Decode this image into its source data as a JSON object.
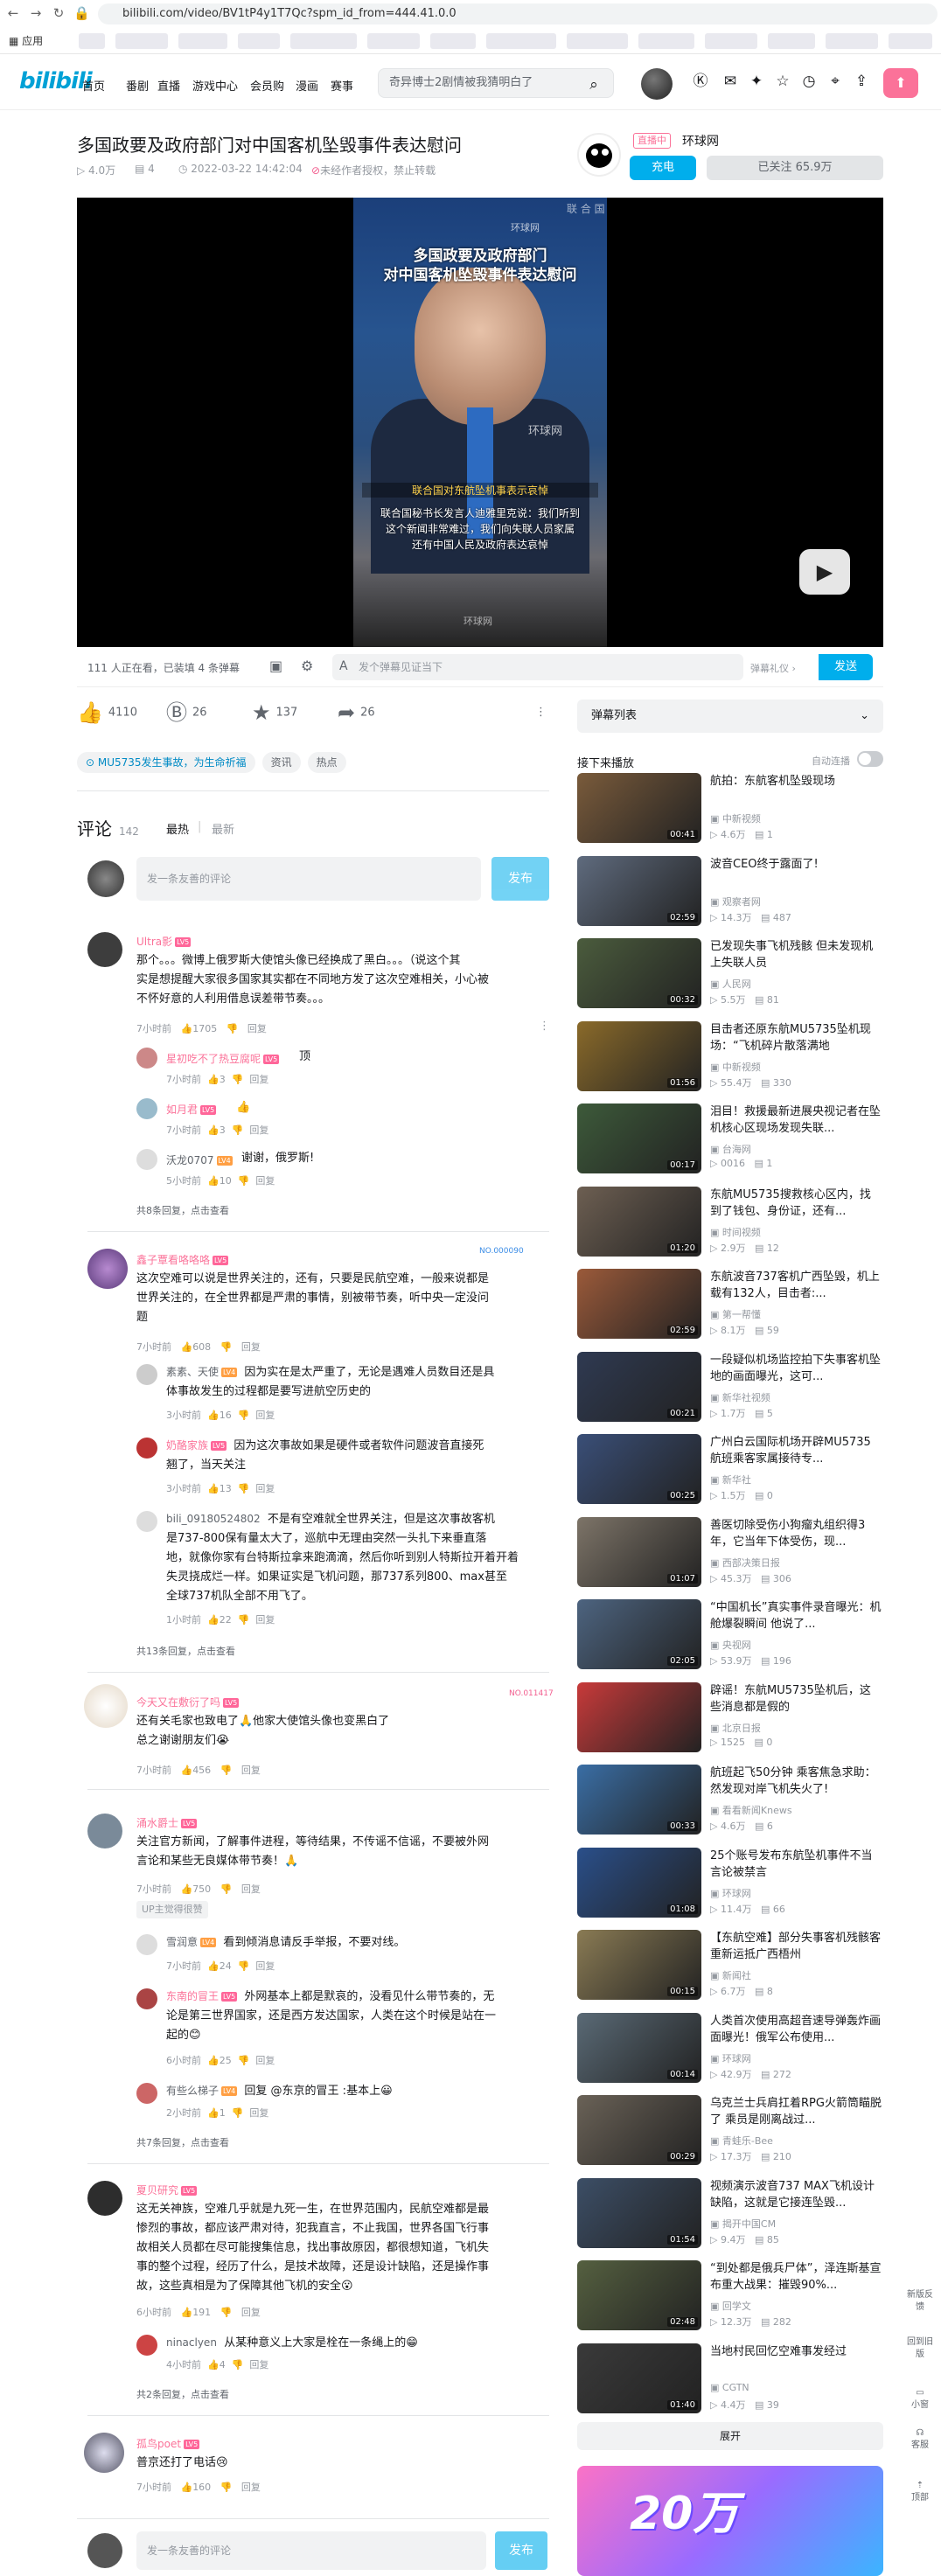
{
  "browser": {
    "url": "bilibili.com/video/BV1tP4y1T7Qc?spm_id_from=444.41.0.0",
    "apps_label": "应用"
  },
  "header": {
    "logo": "bilibili",
    "nav": [
      "首页",
      "番剧",
      "直播",
      "游戏中心",
      "会员购",
      "漫画",
      "赛事"
    ],
    "search_placeholder": "奇异博士2剧情被我猜明白了"
  },
  "video": {
    "title": "多国政要及政府部门对中国客机坠毁事件表达慰问",
    "views": "4.0万",
    "danmaku": "4",
    "date": "2022-03-22 14:42:04",
    "copyright": "未经作者授权，禁止转载",
    "caption_line1": "多国政要及政府部门",
    "caption_line2": "对中国客机坠毁事件表达慰问",
    "watermark": "环球网",
    "lower_red": "联合国对东航坠机事表示哀悼",
    "sub_line1": "联合国秘书长发言人迪雅里克说：我们听到",
    "sub_line2": "这个新闻非常难过，我们向失联人员家属",
    "sub_line3": "还有中国人民及政府表达哀悼",
    "bg_text": "联 合 国"
  },
  "uploader": {
    "live_tag": "直播中",
    "name": "环球网",
    "charge": "充电",
    "follow": "已关注 65.9万"
  },
  "danmaku_bar": {
    "count": "111 人正在看，已装填 4 条弹幕",
    "placeholder": "发个弹幕见证当下",
    "etiquette": "弹幕礼仪 ›",
    "send": "发送"
  },
  "actions": {
    "like": "4110",
    "coin": "26",
    "fav": "137",
    "share": "26"
  },
  "tags": [
    "MU5735发生事故，为生命祈福",
    "资讯",
    "热点"
  ],
  "comments": {
    "title": "评论",
    "count": "142",
    "sort_hot": "最热",
    "sort_new": "最新",
    "input_placeholder": "发一条友善的评论",
    "send": "发布",
    "items": [
      {
        "name": "Ultra影",
        "text1": "那个。。。微博上俄罗斯大使馆头像已经换成了黑白。。。（说这个其",
        "text2": "实是想提醒大家很多国家其实都在不同地方发了这次空难相关，小心被",
        "text3": "不怀好意的人利用借息误差带节奏。。。",
        "time": "7小时前",
        "likes": "1705",
        "reply": "回复"
      },
      {
        "name": "星初吃不了热豆腐呢",
        "text1": "顶",
        "time": "7小时前",
        "likes": "3",
        "reply": "回复"
      },
      {
        "name": "如月君",
        "text1": "👍",
        "time": "7小时前",
        "likes": "3",
        "reply": "回复"
      },
      {
        "name": "沃龙0707",
        "text1": "谢谢，俄罗斯!",
        "time": "5小时前",
        "likes": "10",
        "reply": "回复"
      },
      {
        "more": "共8条回复，点击查看"
      },
      {
        "name": "鑫子覃看咯咯咯",
        "badge": "NO.000090",
        "text1": "这次空难可以说是世界关注的，还有，只要是民航空难，一般来说都是",
        "text2": "世界关注的，在全世界都是严肃的事情，别被带节奏，听中央一定没问",
        "text3": "题",
        "time": "7小时前",
        "likes": "608",
        "reply": "回复"
      },
      {
        "name": "素素、天使",
        "text1": "因为实在是太严重了，无论是遇难人员数目还是具",
        "text2": "体事故发生的过程都是要写进航空历史的",
        "time": "3小时前",
        "likes": "16",
        "reply": "回复"
      },
      {
        "name": "奶酪家族",
        "text1": "因为这次事故如果是硬件或者软件问题波音直接死",
        "text2": "翘了，当天关注",
        "time": "3小时前",
        "likes": "13",
        "reply": "回复"
      },
      {
        "name": "bili_09180524802",
        "text1": "不是有空难就全世界关注，但是这次事故客机",
        "text2": "是737-800保有量太大了，巡航中无理由突然一头扎下来垂直落",
        "text3": "地，就像你家有台特斯拉拿来跑滴滴，然后你听到别人特斯拉开着开着",
        "text4": "失灵挠成烂一样。如果证实是飞机问题，那737系列800、max甚至",
        "text5": "全球737机队全部不用飞了。",
        "time": "1小时前",
        "likes": "22",
        "reply": "回复"
      },
      {
        "more": "共13条回复，点击查看"
      },
      {
        "name": "今天又在敷衍了吗",
        "badge": "NO.011417",
        "text1": "还有关毛家也致电了🙏他家大使馆头像也变黑白了",
        "text2": "总之谢谢朋友们😭",
        "time": "7小时前",
        "likes": "456",
        "reply": "回复"
      },
      {
        "name": "涌水爵士",
        "text1": "关注官方新闻，了解事件进程，等待结果，不传谣不信谣，不要被外网",
        "text2": "言论和某些无良媒体带节奏！🙏",
        "time": "7小时前",
        "likes": "750",
        "reply": "回复",
        "uptag": "UP主觉得很赞"
      },
      {
        "name": "雪润意",
        "text1": "看到倾消息请反手举报，不要对线。",
        "time": "7小时前",
        "likes": "24",
        "reply": "回复"
      },
      {
        "name": "东南的冒王",
        "text1": "外网基本上都是默哀的，没看见什么带节奏的，无",
        "text2": "论是第三世界国家，还是西方发达国家，人类在这个时候是站在一",
        "text3": "起的😊",
        "time": "6小时前",
        "likes": "25",
        "reply": "回复"
      },
      {
        "name": "有些么梯子",
        "text1": "回复 @东京的冒王 :基本上😀",
        "time": "2小时前",
        "likes": "1",
        "reply": "回复"
      },
      {
        "more": "共7条回复，点击查看"
      },
      {
        "name": "夏贝研究",
        "text1": "这无关神族，空难几乎就是九死一生，在世界范围内，民航空难都是最",
        "text2": "惨烈的事故，都应该严肃对待，犯我直言，不止我国，世界各国飞行事",
        "text3": "故相关人员都在尽可能搜集信息，找出事故原因，都很想知道，飞机失",
        "text4": "事的整个过程，经历了什么，是技术故障，还是设计缺陷，还是操作事",
        "text5": "故，这些真相是为了保障其他飞机的安全😮",
        "time": "6小时前",
        "likes": "191",
        "reply": "回复"
      },
      {
        "name": "ninaclyen",
        "text1": "从某种意义上大家是栓在一条绳上的😁",
        "time": "4小时前",
        "likes": "4",
        "reply": "回复"
      },
      {
        "more": "共2条回复，点击查看"
      },
      {
        "name": "孤鸟poet",
        "text1": "普京还打了电话😢",
        "time": "7小时前",
        "likes": "160",
        "reply": "回复"
      }
    ]
  },
  "sidebar": {
    "danmaku_list": "弹幕列表",
    "next_label": "接下来播放",
    "autoplay": "自动连播",
    "expand": "展开",
    "banner": "20万",
    "recs": [
      {
        "title": "航拍：东航客机坠毁现场",
        "up": "中新视频",
        "views": "4.6万",
        "dm": "1",
        "dur": "00:41",
        "color": "#7a5b3b"
      },
      {
        "title": "波音CEO终于露面了!",
        "up": "观察者网",
        "views": "14.3万",
        "dm": "487",
        "dur": "02:59",
        "color": "#5f6b7e"
      },
      {
        "title": "已发现失事飞机残骸 但未发现机上失联人员",
        "up": "人民网",
        "views": "5.5万",
        "dm": "81",
        "dur": "00:32",
        "color": "#4b5c3d"
      },
      {
        "title": "目击者还原东航MU5735坠机现场：“飞机碎片散落满地",
        "up": "中新视频",
        "views": "55.4万",
        "dm": "330",
        "dur": "01:56",
        "color": "#8a6a2a"
      },
      {
        "title": "泪目！救援最新进展央视记者在坠机核心区现场发现失联...",
        "up": "台海网",
        "views": "0016",
        "dm": "1",
        "dur": "00:17",
        "color": "#3d5a3a"
      },
      {
        "title": "东航MU5735搜救核心区内，找到了钱包、身份证，还有...",
        "up": "时间视频",
        "views": "2.9万",
        "dm": "12",
        "dur": "01:20",
        "color": "#6d5f52"
      },
      {
        "title": "东航波音737客机广西坠毁，机上载有132人，目击者:...",
        "up": "第一帮懂",
        "views": "8.1万",
        "dm": "59",
        "dur": "02:59",
        "color": "#9b5a3a"
      },
      {
        "title": "一段疑似机场监控拍下失事客机坠地的画面曝光，这可...",
        "up": "新华社视频",
        "views": "1.7万",
        "dm": "5",
        "dur": "00:21",
        "color": "#2f3a52"
      },
      {
        "title": "广州白云国际机场开辟MU5735航班乘客家属接待专...",
        "up": "新华社",
        "views": "1.5万",
        "dm": "0",
        "dur": "00:25",
        "color": "#3a4f78"
      },
      {
        "title": "善医切除受伤小狗瘤丸组织得3年，它当年下体受伤，现...",
        "up": "西部决策日报",
        "views": "45.3万",
        "dm": "306",
        "dur": "01:07",
        "color": "#7d7468"
      },
      {
        "title": "“中国机长”真实事件录音曝光：机舱爆裂瞬间 他说了...",
        "up": "央视网",
        "views": "53.9万",
        "dm": "196",
        "dur": "02:05",
        "color": "#4d6480"
      },
      {
        "title": "辟谣！东航MU5735坠机后，这些消息都是假的",
        "up": "北京日报",
        "views": "1525",
        "dm": "0",
        "dur": "",
        "color": "#c83a3a"
      },
      {
        "title": "航班起飞50分钟 乘客焦急求助：然发现对岸飞机失火了!",
        "up": "看看新闻Knews",
        "views": "4.6万",
        "dm": "6",
        "dur": "00:33",
        "color": "#3a6ea5"
      },
      {
        "title": "25个账号发布东航坠机事件不当言论被禁言",
        "up": "环球网",
        "views": "11.4万",
        "dm": "66",
        "dur": "01:08",
        "color": "#2a4f8a"
      },
      {
        "title": "【东航空难】部分失事客机残骸客重新运抵广西梧州",
        "up": "新闻社",
        "views": "6.7万",
        "dm": "8",
        "dur": "00:15",
        "color": "#8a7b54"
      },
      {
        "title": "人类首次使用高超音速导弹轰炸画面曝光！俄军公布使用...",
        "up": "环球网",
        "views": "42.9万",
        "dm": "272",
        "dur": "00:14",
        "color": "#5a6a76"
      },
      {
        "title": "乌克兰士兵肩扛着RPG火箭筒瞄脱了 乘员是刚离战过...",
        "up": "青蛙乐-Bee",
        "views": "17.3万",
        "dm": "210",
        "dur": "00:29",
        "color": "#6a6257"
      },
      {
        "title": "视频演示波音737 MAX飞机设计缺陷，这就是它接连坠毁...",
        "up": "揭开中国CM",
        "views": "9.4万",
        "dm": "85",
        "dur": "01:54",
        "color": "#3c4e66"
      },
      {
        "title": "“到处都是俄兵尸体”，泽连斯基宣布重大战果：摧毁90%...",
        "up": "回学文",
        "views": "12.3万",
        "dm": "282",
        "dur": "02:48",
        "color": "#556040"
      },
      {
        "title": "当地村民回忆空难事发经过",
        "up": "CGTN",
        "views": "4.4万",
        "dm": "39",
        "dur": "01:40",
        "color": "#3a3a3a"
      }
    ]
  },
  "float": [
    "新版反馈",
    "回到旧版",
    "小窗",
    "客服",
    "顶部"
  ],
  "bottom_input": {
    "placeholder": "发一条友善的评论",
    "send": "发布"
  }
}
